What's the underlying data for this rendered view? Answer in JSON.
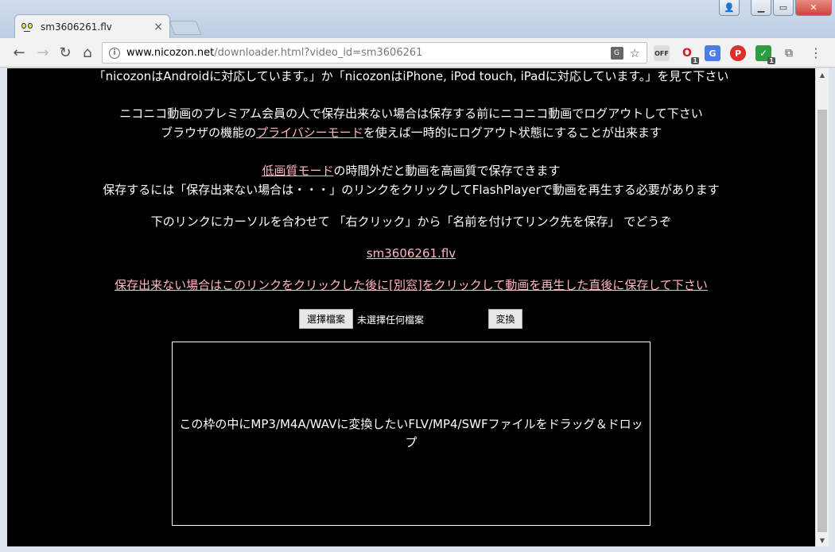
{
  "browser": {
    "tab_title": "sm3606261.flv",
    "tab_close": "×",
    "url_host": "www.nicozon.net",
    "url_path": "/downloader.html?video_id=sm3606261",
    "window_controls": {
      "user": "👤",
      "minimize": "▁",
      "maximize": "▭",
      "close": "✕"
    },
    "nav": {
      "back": "←",
      "forward": "→",
      "reload": "↻",
      "home": "⌂"
    },
    "bookmark_star": "☆",
    "menu": "⋮",
    "extensions": [
      {
        "name": "OFF",
        "badge": ""
      },
      {
        "name": "O",
        "badge": "1"
      },
      {
        "name": "G",
        "badge": ""
      },
      {
        "name": "P",
        "badge": ""
      },
      {
        "name": "✓",
        "badge": "1"
      },
      {
        "name": "⧉",
        "badge": ""
      }
    ]
  },
  "page": {
    "line1": "「nicozonはAndroidに対応しています。」か「nicozonはiPhone, iPod touch, iPadに対応しています。」を見て下さい",
    "line2": "ニコニコ動画のプレミアム会員の人で保存出来ない場合は保存する前にニコニコ動画でログアウトして下さい",
    "line3_pre": "ブラウザの機能の",
    "line3_link": "プライバシーモード",
    "line3_post": "を使えば一時的にログアウト状態にすることが出来ます",
    "line4_link": "低画質モード",
    "line4_post": "の時間外だと動画を高画質で保存できます",
    "line5": "保存するには「保存出来ない場合は・・・」のリンクをクリックしてFlashPlayerで動画を再生する必要があります",
    "line6": "下のリンクにカーソルを合わせて 「右クリック」から「名前を付けてリンク先を保存」 でどうぞ",
    "file_link": "sm3606261.flv",
    "cannot_save_link": "保存出来ない場合はこのリンクをクリックした後に[別窓]をクリックして動画を再生した直後に保存して下さい",
    "choose_file_button": "選擇檔案",
    "file_status": "未選擇任何檔案",
    "convert_button": "変換",
    "dropzone_text": "この枠の中にMP3/M4A/WAVに変換したいFLV/MP4/SWFファイルをドラッグ＆ドロップ"
  },
  "colors": {
    "page_background": "#000000",
    "page_text": "#ffffff",
    "link": "#ffb6c1"
  }
}
